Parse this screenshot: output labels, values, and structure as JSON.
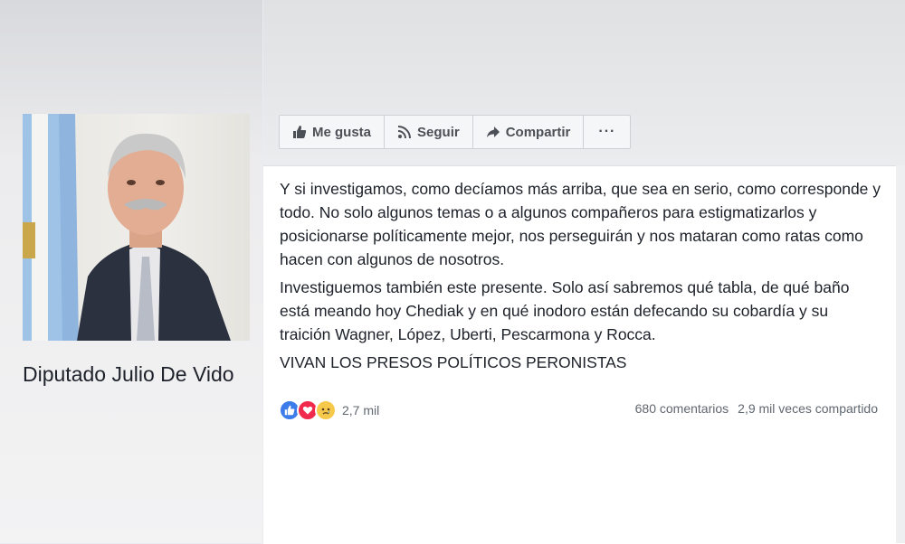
{
  "sidebar": {
    "page_name": "Diputado Julio De Vido",
    "avatar_icon": "profile-photo",
    "colors": {
      "background": "#ececee"
    }
  },
  "action_bar": {
    "like_label": "Me gusta",
    "follow_label": "Seguir",
    "share_label": "Compartir",
    "more_label": "···"
  },
  "post": {
    "paragraphs": [
      "Y si investigamos, como decíamos más arriba, que sea en serio, como corresponde y todo. No solo algunos temas o a algunos compañeros para estigmatizarlos y posicionarse políticamente mejor, nos perseguirán y nos mataran como ratas como hacen con algunos de nosotros.",
      "Investiguemos también este presente. Solo así sabremos qué tabla, de qué baño está meando hoy Chediak y en qué inodoro están defecando su cobardía y su traición Wagner, López, Uberti, Pescarmona y Rocca.",
      "VIVAN LOS PRESOS POLÍTICOS PERONISTAS"
    ],
    "reactions": {
      "icons": [
        "like-reaction-icon",
        "love-reaction-icon",
        "sad-reaction-icon"
      ],
      "count": "2,7 mil"
    },
    "comments": "680 comentarios",
    "shares": "2,9 mil veces compartido"
  },
  "colors": {
    "text": "#1d2129",
    "secondary_text": "#606770",
    "like_blue": "#3b7bea",
    "love_red": "#f0294d",
    "sad_yellow": "#f7c94b"
  }
}
